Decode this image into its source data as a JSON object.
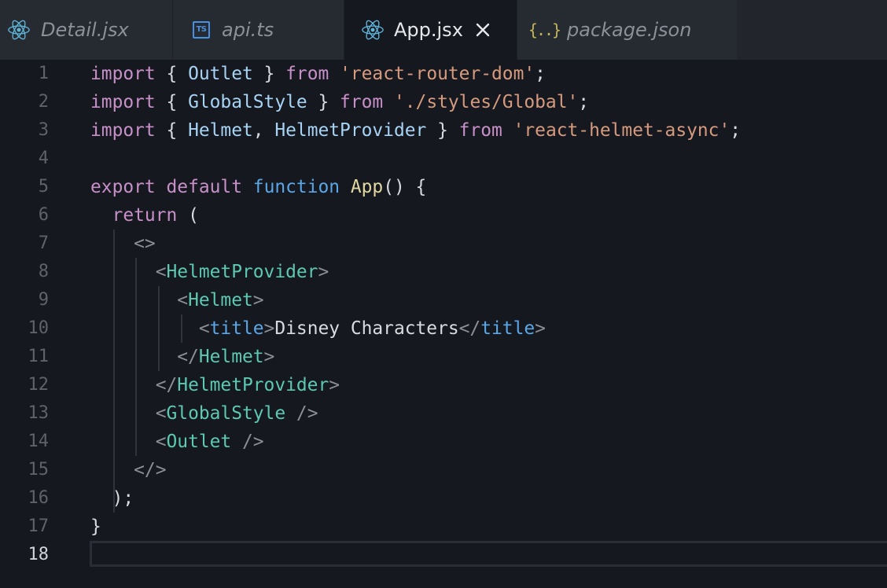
{
  "tabs": [
    {
      "name": "Detail.jsx",
      "icon": "react-icon",
      "active": false
    },
    {
      "name": "api.ts",
      "icon": "typescript-icon",
      "icon_text": "TS",
      "active": false
    },
    {
      "name": "App.jsx",
      "icon": "react-icon",
      "active": true
    },
    {
      "name": "package.json",
      "icon": "json-icon",
      "icon_text": "{..}",
      "active": false
    }
  ],
  "colors": {
    "editor_bg": "#16181f",
    "tabbar_bg": "#262a31",
    "keyword": "#c790c8",
    "identifier": "#a7d3f5",
    "string": "#d69a7e",
    "function": "#e0d8a0",
    "jsx_tag": "#5cc9b2",
    "html_tag": "#5ba6e6",
    "react_icon": "#5fb4d8"
  },
  "editor": {
    "current_line": 18,
    "line_numbers": [
      "1",
      "2",
      "3",
      "4",
      "5",
      "6",
      "7",
      "8",
      "9",
      "10",
      "11",
      "12",
      "13",
      "14",
      "15",
      "16",
      "17",
      "18"
    ],
    "lines": [
      [
        [
          "kw",
          "import"
        ],
        [
          "pn",
          " { "
        ],
        [
          "id",
          "Outlet"
        ],
        [
          "pn",
          " } "
        ],
        [
          "kw",
          "from"
        ],
        [
          "pn",
          " "
        ],
        [
          "st",
          "'react-router-dom'"
        ],
        [
          "pn",
          ";"
        ]
      ],
      [
        [
          "kw",
          "import"
        ],
        [
          "pn",
          " { "
        ],
        [
          "id",
          "GlobalStyle"
        ],
        [
          "pn",
          " } "
        ],
        [
          "kw",
          "from"
        ],
        [
          "pn",
          " "
        ],
        [
          "st",
          "'./styles/Global'"
        ],
        [
          "pn",
          ";"
        ]
      ],
      [
        [
          "kw",
          "import"
        ],
        [
          "pn",
          " { "
        ],
        [
          "id",
          "Helmet"
        ],
        [
          "pn",
          ", "
        ],
        [
          "id",
          "HelmetProvider"
        ],
        [
          "pn",
          " } "
        ],
        [
          "kw",
          "from"
        ],
        [
          "pn",
          " "
        ],
        [
          "st",
          "'react-helmet-async'"
        ],
        [
          "pn",
          ";"
        ]
      ],
      [],
      [
        [
          "kw",
          "export"
        ],
        [
          "pn",
          " "
        ],
        [
          "kw",
          "default"
        ],
        [
          "pn",
          " "
        ],
        [
          "kb",
          "function"
        ],
        [
          "pn",
          " "
        ],
        [
          "fn",
          "App"
        ],
        [
          "pn",
          "() {"
        ]
      ],
      [
        [
          "pn",
          "  "
        ],
        [
          "kw",
          "return"
        ],
        [
          "pn",
          " ("
        ]
      ],
      [
        [
          "pn",
          "    "
        ],
        [
          "br",
          "<>"
        ]
      ],
      [
        [
          "pn",
          "      "
        ],
        [
          "br",
          "<"
        ],
        [
          "tg",
          "HelmetProvider"
        ],
        [
          "br",
          ">"
        ]
      ],
      [
        [
          "pn",
          "        "
        ],
        [
          "br",
          "<"
        ],
        [
          "tg",
          "Helmet"
        ],
        [
          "br",
          ">"
        ]
      ],
      [
        [
          "pn",
          "          "
        ],
        [
          "br",
          "<"
        ],
        [
          "th",
          "title"
        ],
        [
          "br",
          ">"
        ],
        [
          "tx",
          "Disney Characters"
        ],
        [
          "br",
          "</"
        ],
        [
          "th",
          "title"
        ],
        [
          "br",
          ">"
        ]
      ],
      [
        [
          "pn",
          "        "
        ],
        [
          "br",
          "</"
        ],
        [
          "tg",
          "Helmet"
        ],
        [
          "br",
          ">"
        ]
      ],
      [
        [
          "pn",
          "      "
        ],
        [
          "br",
          "</"
        ],
        [
          "tg",
          "HelmetProvider"
        ],
        [
          "br",
          ">"
        ]
      ],
      [
        [
          "pn",
          "      "
        ],
        [
          "br",
          "<"
        ],
        [
          "tg",
          "GlobalStyle"
        ],
        [
          "pn",
          " "
        ],
        [
          "br",
          "/>"
        ]
      ],
      [
        [
          "pn",
          "      "
        ],
        [
          "br",
          "<"
        ],
        [
          "tg",
          "Outlet"
        ],
        [
          "pn",
          " "
        ],
        [
          "br",
          "/>"
        ]
      ],
      [
        [
          "pn",
          "    "
        ],
        [
          "br",
          "</>"
        ]
      ],
      [
        [
          "pn",
          "  );"
        ]
      ],
      [
        [
          "pn",
          "}"
        ]
      ],
      []
    ]
  }
}
